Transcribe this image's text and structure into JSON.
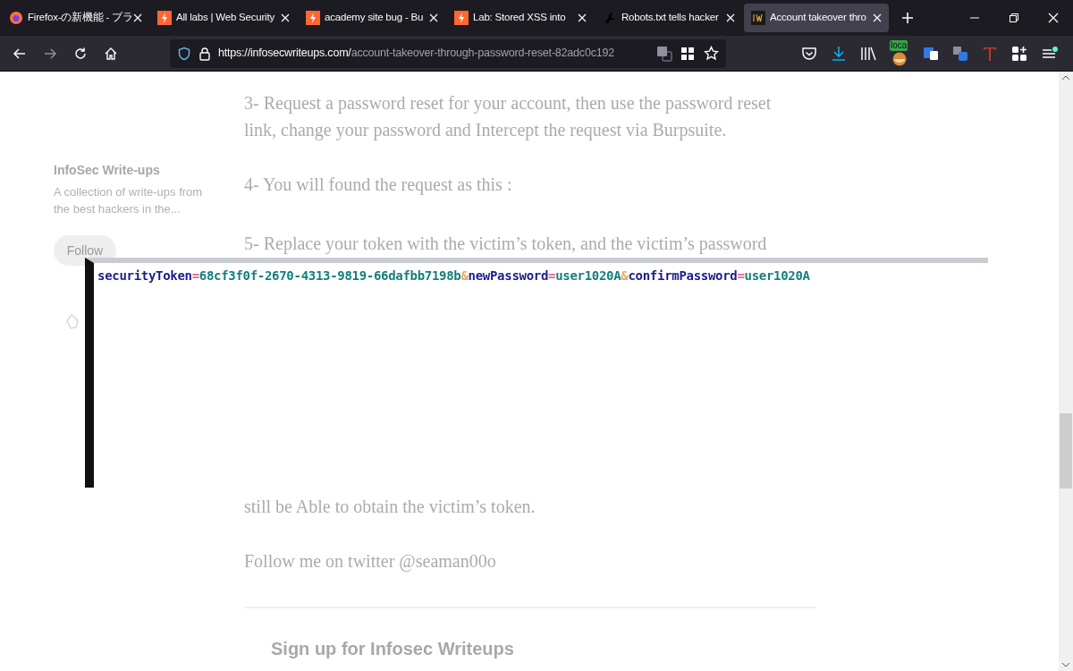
{
  "tabs": [
    {
      "title": "Firefox-の新機能 - プラ",
      "kind": "browser",
      "selected": false
    },
    {
      "title": "All labs | Web Security",
      "kind": "lab",
      "selected": false
    },
    {
      "title": "academy site bug - Bu",
      "kind": "lab",
      "selected": false
    },
    {
      "title": "Lab: Stored XSS into",
      "kind": "lab",
      "selected": false
    },
    {
      "title": "Robots.txt tells hacker",
      "kind": "blog",
      "selected": false
    },
    {
      "title": "Account takeover thro",
      "kind": "publication",
      "selected": true
    }
  ],
  "url": {
    "host": "https://infosecwriteups.com/",
    "path": "account-takeover-through-password-reset-82adc0c192"
  },
  "extension_badge": "loca",
  "sidebar": {
    "publication": "InfoSec Write-ups",
    "description": [
      "A collection of write-ups from",
      "the best hackers in the..."
    ],
    "follow_button": "Follow"
  },
  "article": {
    "paragraphs_above": [
      "3- Request a password reset for your account, then use the password reset",
      "link, change your password and Intercept the request via Burpsuite.",
      "4- You will found the request as this :",
      "5- Replace your token with the victim’s token, and the victim’s password"
    ],
    "paragraphs_below": [
      "still be Able to obtain the victim’s token.",
      "Follow me on twitter @seaman00o"
    ],
    "signup_heading": "Sign up for Infosec Writeups"
  },
  "request_image": {
    "tokens": [
      {
        "text": "securityToken",
        "kind": "key"
      },
      {
        "text": "=",
        "kind": "sep"
      },
      {
        "text": "68cf3f0f-2670-4313-9819-66dafbb7198b",
        "kind": "value"
      },
      {
        "text": "&",
        "kind": "amp"
      },
      {
        "text": "newPassword",
        "kind": "key"
      },
      {
        "text": "=",
        "kind": "sep"
      },
      {
        "text": "user1020A",
        "kind": "value"
      },
      {
        "text": "&",
        "kind": "amp"
      },
      {
        "text": "confirmPassword",
        "kind": "key"
      },
      {
        "text": "=",
        "kind": "sep"
      },
      {
        "text": "user1020A",
        "kind": "value"
      }
    ]
  }
}
